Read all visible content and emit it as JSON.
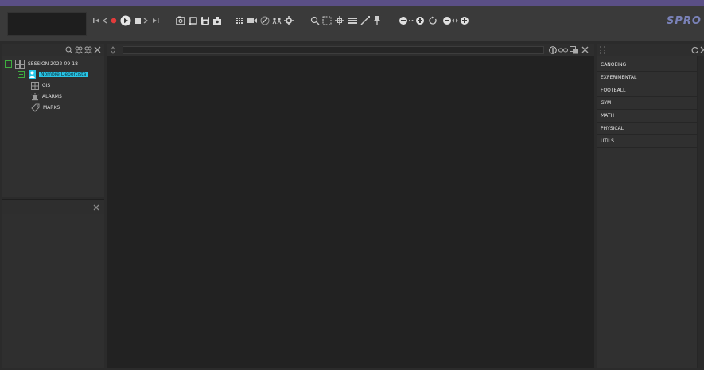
{
  "logo": "SPRO",
  "colors": {
    "accent": "#28c6e8",
    "selected_text": "#0d2b33",
    "title_strip": "#5a4f86",
    "tree_green": "#3fae3f",
    "record_red": "#e23b3b"
  },
  "toolbar": {
    "playback": [
      "skip-start-icon",
      "step-back-icon",
      "record-icon",
      "play-icon",
      "stop-icon",
      "step-forward-icon",
      "skip-end-icon"
    ],
    "media": [
      "image-capture-icon",
      "crop-icon",
      "save-icon",
      "camera-icon"
    ],
    "view": [
      "grid-icon",
      "video-icon",
      "pen-icon",
      "connect-icon",
      "gear-icon"
    ],
    "tools": [
      "zoom-icon",
      "marquee-icon",
      "move-icon",
      "bars-icon",
      "line-icon",
      "pin-icon"
    ],
    "zoom": [
      "zoom-out-icon",
      "zoom-in-icon",
      "rotate-icon",
      "shrink-icon",
      "expand-icon"
    ]
  },
  "tree": {
    "root": "SESSION 2022-09-18",
    "athlete": "Nombre Deportista",
    "items": [
      "GIS",
      "ALARMS",
      "MARKS"
    ]
  },
  "panels": {
    "left_bottom_close": "×",
    "right_close": "×"
  },
  "categories": [
    "CANOEING",
    "EXPERIMENTAL",
    "FOOTBALL",
    "GYM",
    "MATH",
    "PHYSICAL",
    "UTILS"
  ]
}
